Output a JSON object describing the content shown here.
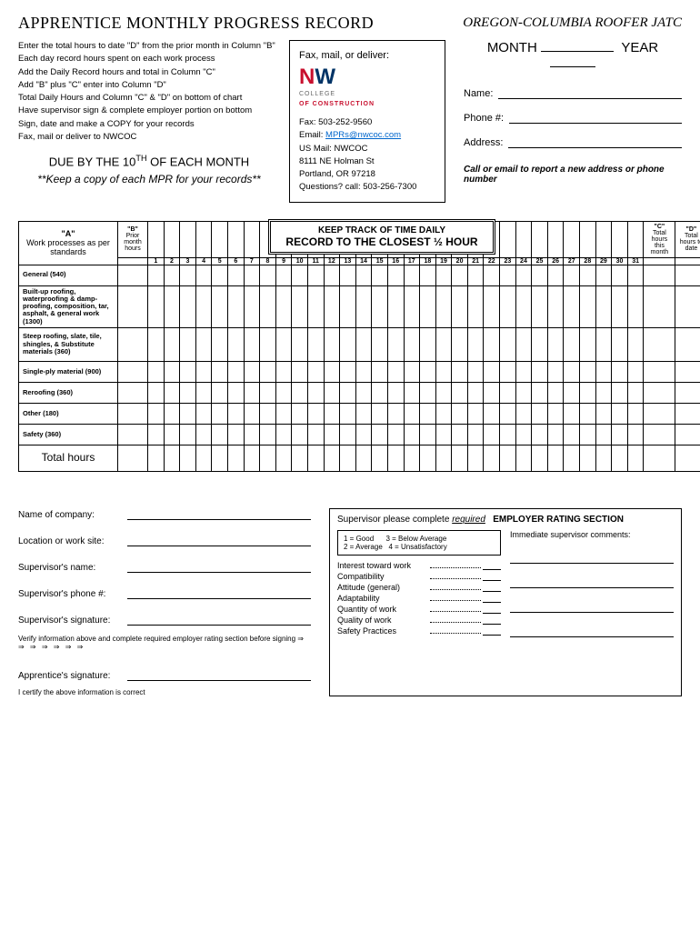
{
  "header": {
    "title_left": "APPRENTICE MONTHLY PROGRESS RECORD",
    "title_right": "OREGON-COLUMBIA ROOFER JATC"
  },
  "instructions": [
    "Enter the total hours to date \"D\" from the prior month in Column \"B\"",
    "Each day record hours spent on each work process",
    "Add the Daily Record hours and total in Column \"C\"",
    "Add \"B\" plus \"C\" enter into Column \"D\"",
    "Total Daily Hours and Column \"C\" & \"D\" on bottom of chart",
    "Have supervisor sign & complete employer portion on bottom",
    "Sign, date and make a COPY for your records",
    "Fax, mail or deliver to NWCOC"
  ],
  "due": "DUE BY THE 10",
  "due_sup": "TH",
  "due_after": " OF EACH MONTH",
  "keep_copy": "**Keep a copy of each MPR for your records**",
  "contact": {
    "deliver": "Fax, mail, or deliver:",
    "college": "COLLEGE",
    "of_construction": "OF CONSTRUCTION",
    "fax": "Fax: 503-252-9560",
    "email_label": "Email: ",
    "email": "MPRs@nwcoc.com",
    "mail": "US Mail: NWCOC",
    "addr1": "8111 NE Holman St",
    "addr2": "Portland, OR 97218",
    "questions": "Questions? call: 503-256-7300"
  },
  "form": {
    "month": "MONTH",
    "year": "YEAR",
    "name": "Name:",
    "phone": "Phone #:",
    "address": "Address:",
    "call_note": "Call or email to report a new address or phone number"
  },
  "banner": {
    "line1": "KEEP TRACK OF TIME DAILY",
    "line2": "RECORD TO THE CLOSEST ½ HOUR"
  },
  "grid": {
    "colA_h1": "\"A\"",
    "colA_h2": "Work processes as per standards",
    "colB_h1": "\"B\"",
    "colB_h2": "Prior month hours",
    "colC_h1": "\"C\"",
    "colC_h2": "Total hours this month",
    "colD_h1": "\"D\"",
    "colD_h2": "Total hours to date",
    "days": [
      "1",
      "2",
      "3",
      "4",
      "5",
      "6",
      "7",
      "8",
      "9",
      "10",
      "11",
      "12",
      "13",
      "14",
      "15",
      "16",
      "17",
      "18",
      "19",
      "20",
      "21",
      "22",
      "23",
      "24",
      "25",
      "26",
      "27",
      "28",
      "29",
      "30",
      "31"
    ],
    "rows": [
      "General (540)",
      "Built-up roofing, waterproofing & damp-proofing, composition, tar, asphalt, & general work (1300)",
      "Steep roofing, slate, tile, shingles, & Substitute materials (360)",
      "Single-ply material (900)",
      "Reroofing (360)",
      "Other (180)",
      "Safety (360)"
    ],
    "total_row": "Total hours"
  },
  "bottom_left": {
    "company": "Name of company:",
    "location": "Location or work site:",
    "sup_name": "Supervisor's name:",
    "sup_phone": "Supervisor's phone #:",
    "sup_sig": "Supervisor's signature:",
    "verify": "Verify information above and complete required employer rating section before signing",
    "arrows": "⇒ ⇒ ⇒ ⇒ ⇒ ⇒ ⇒",
    "app_sig": "Apprentice's signature:",
    "certify": "I certify the above information is correct"
  },
  "bottom_right": {
    "title_pre": "Supervisor please complete ",
    "title_req": "required",
    "title_emp": "EMPLOYER RATING SECTION",
    "key": {
      "k1": "1 = Good",
      "k2": "2 = Average",
      "k3": "3 = Below Average",
      "k4": "4 = Unsatisfactory"
    },
    "ratings": [
      "Interest toward work",
      "Compatibility",
      "Attitude (general)",
      "Adaptability",
      "Quantity of work",
      "Quality of work",
      "Safety Practices"
    ],
    "comments": "Immediate supervisor comments:"
  }
}
